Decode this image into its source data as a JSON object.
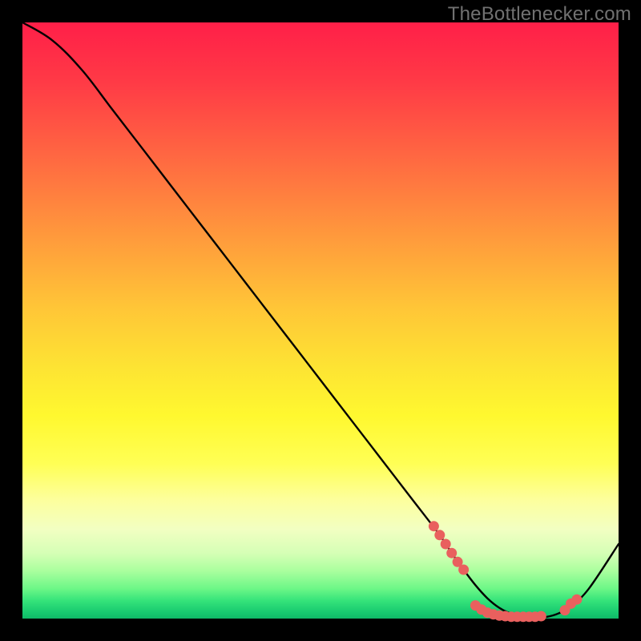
{
  "watermark": "TheBottlenecker.com",
  "colors": {
    "line": "#000000",
    "marker": "#e9605e",
    "gradient_top": "#ff1f48",
    "gradient_bottom": "#0fb968"
  },
  "chart_data": {
    "type": "line",
    "title": "",
    "xlabel": "",
    "ylabel": "",
    "xlim": [
      0,
      100
    ],
    "ylim": [
      0,
      100
    ],
    "grid": false,
    "legend": false,
    "x": [
      0,
      5,
      10,
      15,
      20,
      25,
      30,
      35,
      40,
      45,
      50,
      55,
      60,
      65,
      70,
      72,
      74,
      76,
      78,
      80,
      82,
      84,
      86,
      88,
      90,
      92,
      95,
      100
    ],
    "y": [
      100,
      97,
      92,
      85.5,
      79,
      72.5,
      66,
      59.5,
      53,
      46.5,
      40,
      33.5,
      27,
      20.5,
      14,
      11,
      8.2,
      5.6,
      3.4,
      1.8,
      0.8,
      0.3,
      0.2,
      0.3,
      0.9,
      2.1,
      5.0,
      12.5
    ],
    "marker_points": [
      {
        "x": 69,
        "y": 15.5
      },
      {
        "x": 70,
        "y": 14
      },
      {
        "x": 71,
        "y": 12.5
      },
      {
        "x": 72,
        "y": 11
      },
      {
        "x": 73,
        "y": 9.5
      },
      {
        "x": 74,
        "y": 8.2
      },
      {
        "x": 76,
        "y": 2.2
      },
      {
        "x": 77,
        "y": 1.5
      },
      {
        "x": 78,
        "y": 1.0
      },
      {
        "x": 79,
        "y": 0.7
      },
      {
        "x": 80,
        "y": 0.5
      },
      {
        "x": 81,
        "y": 0.4
      },
      {
        "x": 82,
        "y": 0.3
      },
      {
        "x": 83,
        "y": 0.3
      },
      {
        "x": 84,
        "y": 0.3
      },
      {
        "x": 85,
        "y": 0.3
      },
      {
        "x": 86,
        "y": 0.3
      },
      {
        "x": 87,
        "y": 0.4
      },
      {
        "x": 91,
        "y": 1.4
      },
      {
        "x": 92,
        "y": 2.5
      },
      {
        "x": 93,
        "y": 3.2
      }
    ]
  }
}
